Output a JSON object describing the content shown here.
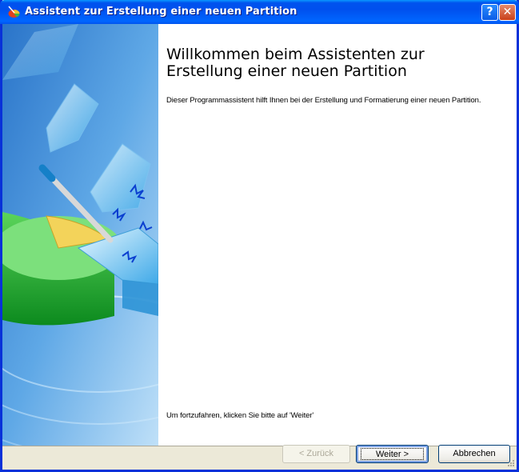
{
  "window": {
    "title": "Assistent zur Erstellung einer neuen Partition",
    "help_symbol": "?",
    "close_symbol": "✕"
  },
  "main": {
    "heading": "Willkommen beim Assistenten zur Erstellung einer neuen Partition",
    "description": "Dieser Programmassistent hilft Ihnen bei der Erstellung und Formatierung einer neuen Partition.",
    "hint": "Um fortzufahren, klicken Sie bitte auf 'Weiter'"
  },
  "buttons": {
    "back": "< Zurück",
    "next": "Weiter >",
    "cancel": "Abbrechen"
  },
  "colors": {
    "titlebar": "#0053EE",
    "border": "#0831D9",
    "button_face": "#ECE9D8",
    "side_blue": "#1E73C8"
  }
}
